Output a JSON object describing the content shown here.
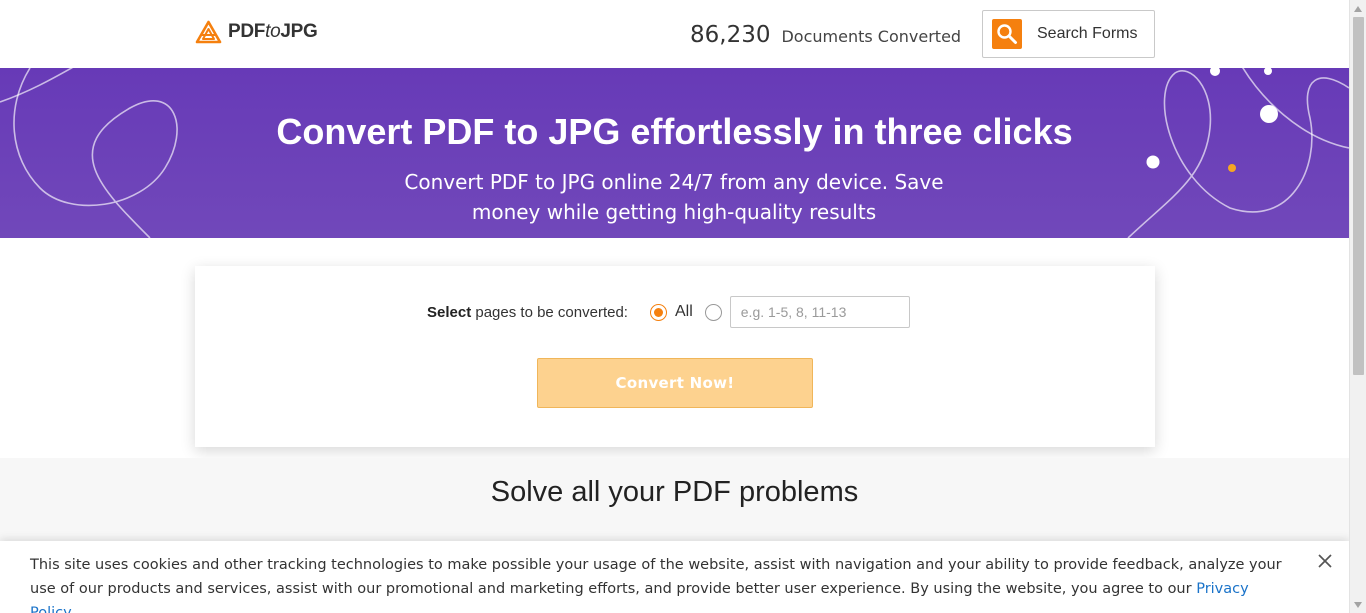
{
  "header": {
    "logo": {
      "part1": "PDF",
      "part2": "to",
      "part3": "JPG"
    },
    "counter": {
      "value": "86,230",
      "label": "Documents Converted"
    },
    "search_label": "Search Forms"
  },
  "hero": {
    "title": "Convert PDF to JPG effortlessly in three clicks",
    "subtitle": "Convert PDF to JPG online 24/7 from any device. Save money while getting high-quality results"
  },
  "converter": {
    "select_bold": "Select",
    "select_rest": " pages to be converted:",
    "all_label": "All",
    "all_selected": true,
    "range_placeholder": "e.g. 1-5, 8, 11-13",
    "range_value": "",
    "convert_label": "Convert Now!"
  },
  "solve": {
    "title": "Solve all your PDF problems"
  },
  "cookie": {
    "text": "This site uses cookies and other tracking technologies to make possible your usage of the website, assist with navigation and your ability to provide feedback, analyze your use of our products and services, assist with our promotional and marketing efforts, and provide better user experience. By using the website, you agree to our ",
    "link_label": "Privacy Policy"
  },
  "colors": {
    "accent": "#f5800f",
    "hero_bg": "#673ab7",
    "convert_button": "#fdd28f",
    "link": "#1a73c9"
  },
  "icons": [
    "logo-icon",
    "search-icon",
    "close-icon",
    "scroll-up-arrow-icon",
    "scroll-down-arrow-icon"
  ]
}
